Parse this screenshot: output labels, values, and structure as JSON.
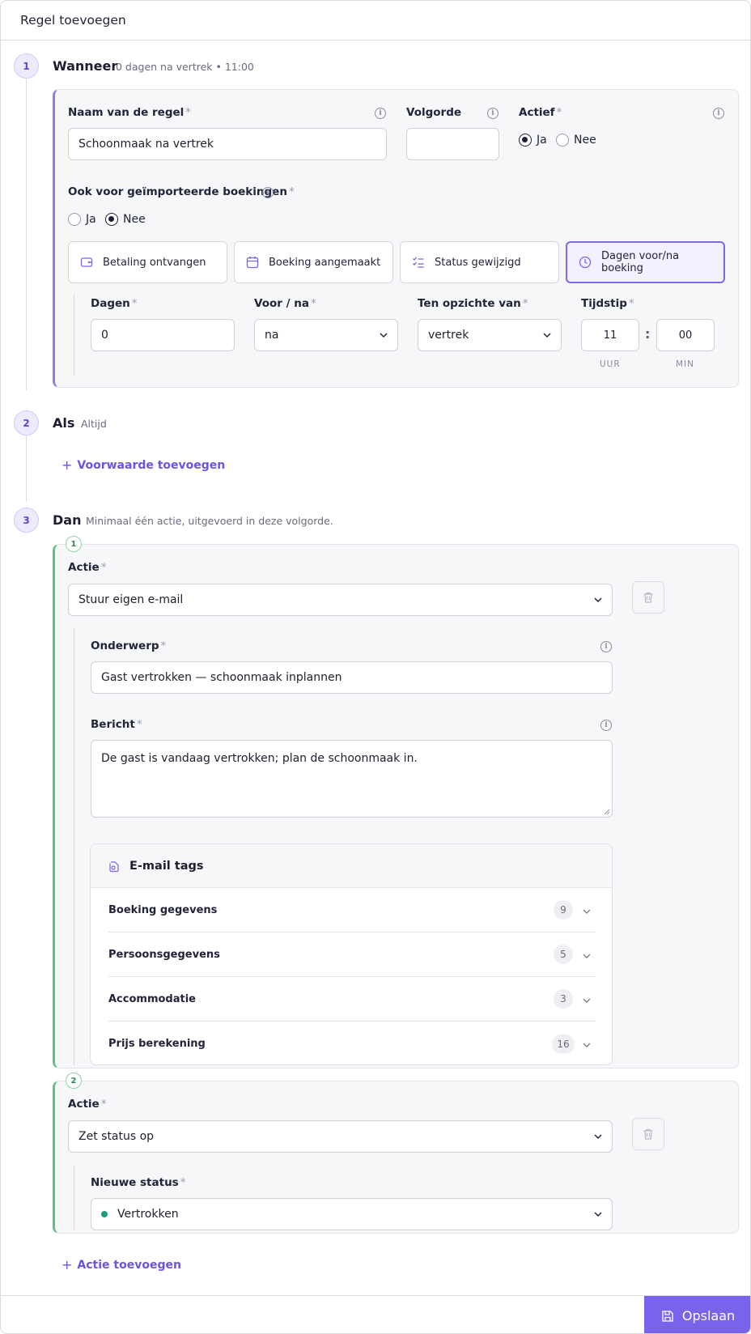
{
  "header": {
    "title": "Regel toevoegen"
  },
  "steps": {
    "wanneer": {
      "num": "1",
      "title": "Wanneer",
      "summary": "0 dagen na vertrek • 11:00"
    },
    "als": {
      "num": "2",
      "title": "Als",
      "summary": "Altijd"
    },
    "dan": {
      "num": "3",
      "title": "Dan",
      "summary": "Minimaal één actie, uitgevoerd in deze volgorde."
    }
  },
  "rule": {
    "name_label": "Naam van de regel",
    "name_value": "Schoonmaak na vertrek",
    "order_label": "Volgorde",
    "order_value": "",
    "active_label": "Actief",
    "active_yes": "Ja",
    "active_no": "Nee",
    "active_selected": "Ja",
    "imported_label": "Ook voor geïmporteerde boekingen",
    "imported_yes": "Ja",
    "imported_no": "Nee",
    "imported_selected": "Nee",
    "required_mark": "*"
  },
  "triggers": [
    {
      "label": "Betaling ontvangen",
      "icon": "wallet-icon"
    },
    {
      "label": "Boeking aangemaakt",
      "icon": "calendar-icon"
    },
    {
      "label": "Status gewijzigd",
      "icon": "checklist-icon"
    },
    {
      "label": "Dagen voor/na boeking",
      "icon": "clock-icon"
    }
  ],
  "active_trigger": "Dagen voor/na boeking",
  "timing": {
    "days_label": "Dagen",
    "days_value": "0",
    "before_after_label": "Voor / na",
    "before_after_value": "na",
    "relative_label": "Ten opzichte van",
    "relative_value": "vertrek",
    "time_label": "Tijdstip",
    "hour": "11",
    "minute": "00",
    "separator": ":",
    "hour_caption": "UUR",
    "minute_caption": "MIN"
  },
  "conditions": {
    "add_label": "Voorwaarde toevoegen"
  },
  "actions": [
    {
      "num": "1",
      "action_label": "Actie",
      "action_value": "Stuur eigen e-mail",
      "subject_label": "Onderwerp",
      "subject_value": "Gast vertrokken — schoonmaak inplannen",
      "message_label": "Bericht",
      "message_value": "De gast is vandaag vertrokken; plan de schoonmaak in.",
      "tags_title": "E-mail tags",
      "tag_groups": [
        {
          "name": "Boeking gegevens",
          "count": "9"
        },
        {
          "name": "Persoonsgegevens",
          "count": "5"
        },
        {
          "name": "Accommodatie",
          "count": "3"
        },
        {
          "name": "Prijs berekening",
          "count": "16"
        }
      ]
    },
    {
      "num": "2",
      "action_label": "Actie",
      "action_value": "Zet status op",
      "status_label": "Nieuwe status",
      "status_value": "Vertrokken",
      "status_color": "#1a9e7a"
    }
  ],
  "add_action_label": "Actie toevoegen",
  "footer": {
    "save_label": "Opslaan"
  },
  "colors": {
    "accent": "#7a62ea",
    "link": "#6a54e0",
    "green": "#5bc27f"
  }
}
